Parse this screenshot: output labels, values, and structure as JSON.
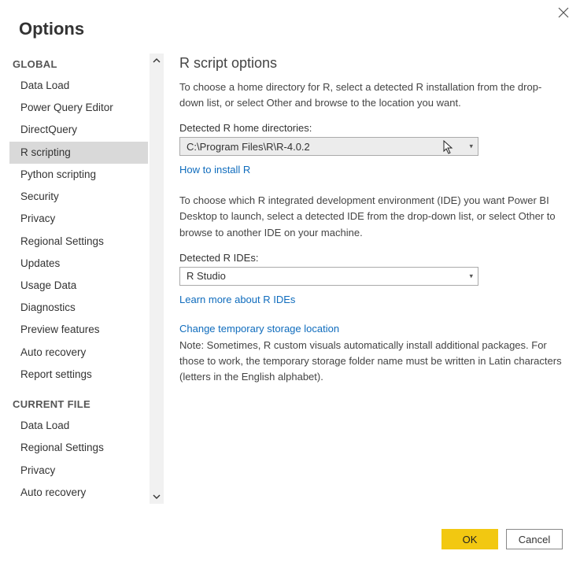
{
  "dialog": {
    "title": "Options"
  },
  "sidebar": {
    "sections": [
      {
        "header": "GLOBAL",
        "items": [
          "Data Load",
          "Power Query Editor",
          "DirectQuery",
          "R scripting",
          "Python scripting",
          "Security",
          "Privacy",
          "Regional Settings",
          "Updates",
          "Usage Data",
          "Diagnostics",
          "Preview features",
          "Auto recovery",
          "Report settings"
        ],
        "selected_index": 3
      },
      {
        "header": "CURRENT FILE",
        "items": [
          "Data Load",
          "Regional Settings",
          "Privacy",
          "Auto recovery"
        ],
        "selected_index": -1
      }
    ]
  },
  "main": {
    "heading": "R script options",
    "intro": "To choose a home directory for R, select a detected R installation from the drop-down list, or select Other and browse to the location you want.",
    "home_label": "Detected R home directories:",
    "home_value": "C:\\Program Files\\R\\R-4.0.2",
    "how_link": "How to install R",
    "ide_intro": "To choose which R integrated development environment (IDE) you want Power BI Desktop to launch, select a detected IDE from the drop-down list, or select Other to browse to another IDE on your machine.",
    "ide_label": "Detected R IDEs:",
    "ide_value": "R Studio",
    "ide_link": "Learn more about R IDEs",
    "temp_link": "Change temporary storage location",
    "temp_note": "Note: Sometimes, R custom visuals automatically install additional packages. For those to work, the temporary storage folder name must be written in Latin characters (letters in the English alphabet)."
  },
  "footer": {
    "ok": "OK",
    "cancel": "Cancel"
  }
}
